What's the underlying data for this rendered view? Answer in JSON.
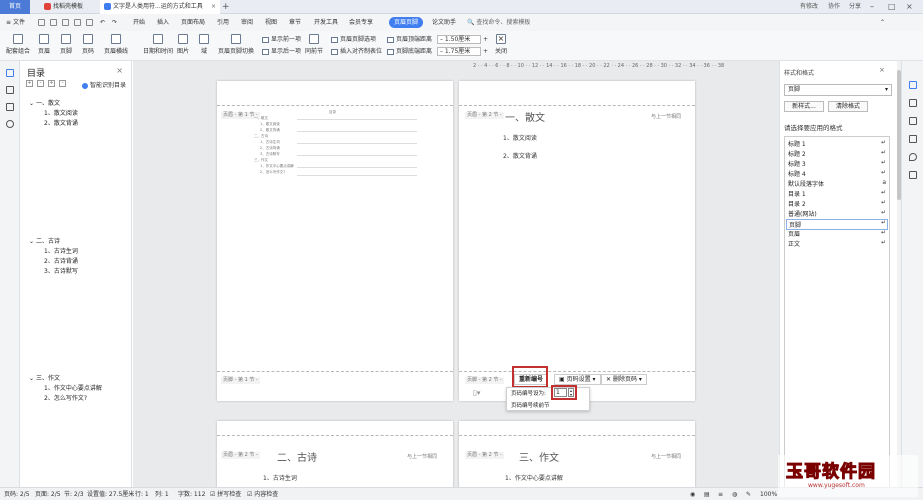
{
  "tabs": {
    "home": "首页",
    "t2": "找稻壳模板",
    "t3": "文字是人类用符...运的方式和工具"
  },
  "window_right": {
    "cloud": "有修改",
    "collab": "协作",
    "share": "分享"
  },
  "menu": {
    "file": "文件",
    "items": [
      "开始",
      "插入",
      "页面布局",
      "引用",
      "审阅",
      "视图",
      "章节",
      "开发工具",
      "会员专享"
    ],
    "active": "页眉页脚",
    "after": "论文助手",
    "search": "查找命令、搜索模板"
  },
  "ribbon": {
    "big": [
      "配套组合",
      "页眉",
      "页脚",
      "页码",
      "页眉横线",
      "日期和时间",
      "图片",
      "域",
      "页眉页脚切换"
    ],
    "r1": "显示前一项",
    "r2": "显示后一项",
    "same": "同前节",
    "hdr_opts": "页眉页脚选项",
    "align": "插入对齐制表位",
    "top_label": "页眉顶端距离",
    "top_val": "1.50厘米",
    "bot_label": "页脚底端距离",
    "bot_val": "1.75厘米",
    "close": "关闭"
  },
  "toc": {
    "title": "目录",
    "smart": "智能识别目录",
    "entries": [
      "一、散文",
      "1、散文阅读",
      "2、散文背诵",
      "二、古诗",
      "1、古诗生词",
      "2、古诗背诵",
      "3、古诗默写",
      "三、作文",
      "1、作文中心要点讲解",
      "2、怎么写作文?"
    ]
  },
  "doc": {
    "p1_header": "页眉 - 第 1 节 -",
    "p1_footer": "页脚 - 第 1 节 -",
    "p1_toc_title": "目录",
    "p1_toc": [
      "一、散文",
      "1、散文阅读",
      "2、散文背诵",
      "二、古诗",
      "1、古诗生词",
      "2、古诗背诵",
      "3、古诗默写",
      "三、作文",
      "1、作文中心要点讲解",
      "2、怎么写作文?"
    ],
    "p2_header": "页眉 - 第 2 节 -",
    "same_as_prev": "与上一节相同",
    "p2_title": "一、散文",
    "p2_items": [
      "1、散文阅读",
      "2、散文背诵"
    ],
    "p2_footer": "页脚 - 第 2 节 -",
    "renumber": "重新编号",
    "page_settings": "页码设置",
    "delete_pn": "删除页码",
    "popup_label": "页码编号设为:",
    "popup_val": "1",
    "popup_cont": "页码编号续前节",
    "p3_header": "页眉 - 第 2 节 -",
    "p3_title": "二、古诗",
    "p3_item": "1、古诗生词",
    "p4_header": "页眉 - 第 2 节 -",
    "p4_title": "三、作文",
    "p4_item": "1、作文中心要点讲解"
  },
  "right_pane": {
    "title": "样式和格式",
    "selected": "页脚",
    "new_style": "新样式...",
    "clear": "清除格式",
    "label": "请选择要应用的格式",
    "styles": [
      "标题 1",
      "标题 2",
      "标题 3",
      "标题 4",
      "默认段落字体",
      "目录 1",
      "目录 2",
      "普通(网站)",
      "页脚",
      "页眉",
      "正文"
    ],
    "selected_index": 8
  },
  "status": {
    "page": "页码: 2/5",
    "pages": "页面: 2/5",
    "section": "节: 2/3",
    "setting": "设置值: 27.5厘米",
    "row": "行: 1",
    "col": "列: 1",
    "chars": "字数: 112",
    "spell": "拼写检查",
    "content": "内容检查",
    "zoom": "100%"
  },
  "watermark": {
    "text": "玉哥软件园",
    "sub": "www.yugesoft.com"
  }
}
